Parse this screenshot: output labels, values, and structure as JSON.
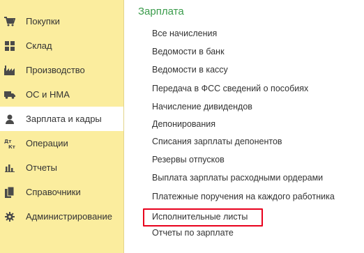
{
  "sidebar": {
    "items": [
      {
        "label": "Покупки",
        "icon": "shopping-cart-icon"
      },
      {
        "label": "Склад",
        "icon": "warehouse-grid-icon"
      },
      {
        "label": "Производство",
        "icon": "factory-icon"
      },
      {
        "label": "ОС и НМА",
        "icon": "truck-icon"
      },
      {
        "label": "Зарплата и кадры",
        "icon": "person-icon"
      },
      {
        "label": "Операции",
        "icon": "debit-credit-icon"
      },
      {
        "label": "Отчеты",
        "icon": "bar-chart-icon"
      },
      {
        "label": "Справочники",
        "icon": "books-icon"
      },
      {
        "label": "Администрирование",
        "icon": "gear-icon"
      }
    ],
    "active_item": "Зарплата и кадры"
  },
  "main": {
    "section_title": "Зарплата",
    "links": [
      "Все начисления",
      "Ведомости в банк",
      "Ведомости в кассу",
      "Передача в ФСС сведений о пособиях",
      "Начисление дивидендов",
      "Депонирования",
      "Списания зарплаты депонентов",
      "Резервы отпусков",
      "Выплата зарплаты расходными ордерами",
      "Платежные поручения на каждого работника",
      "Исполнительные листы",
      "Отчеты по зарплате"
    ],
    "highlighted_link": "Исполнительные листы"
  },
  "colors": {
    "sidebar_bg": "#fbed9e",
    "section_title": "#3a9b4b",
    "highlight_border": "#e8001c",
    "icon": "#4a4a4a"
  }
}
